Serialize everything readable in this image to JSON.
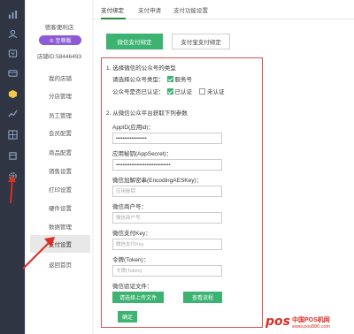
{
  "sidebar": {
    "shop_name": "德客便利店",
    "version_badge": "♔ 至尊版",
    "shop_id": "店铺ID:58446493",
    "items": [
      {
        "label": "我的店铺"
      },
      {
        "label": "分店管理"
      },
      {
        "label": "员工管理"
      },
      {
        "label": "会员配置"
      },
      {
        "label": "商品配置"
      },
      {
        "label": "销售设置"
      },
      {
        "label": "打印设置"
      },
      {
        "label": "硬件设置"
      },
      {
        "label": "数据管理"
      },
      {
        "label": "支付设置",
        "active": true
      },
      {
        "label": "返回首页"
      }
    ]
  },
  "rail_icons": [
    "bar-chart-icon",
    "user-icon",
    "cart-icon",
    "wallet-icon",
    "box-icon",
    "trend-icon",
    "grid-icon",
    "settings-icon"
  ],
  "tabs": [
    {
      "label": "支付绑定",
      "active": true
    },
    {
      "label": "支付申请"
    },
    {
      "label": "支付功能设置"
    }
  ],
  "bind_buttons": {
    "wechat": "微信支付绑定",
    "alipay": "支付宝支付绑定"
  },
  "section1": {
    "title": "1. 选择微信的公众号的类型",
    "type_label": "请选择公众号类型：",
    "type_option": "服务号",
    "type_checked": true,
    "verified_label": "公众号是否已认证：",
    "verified_option": "已认证",
    "verified_checked": true,
    "unverified_option": "未认证",
    "unverified_checked": false
  },
  "section2": {
    "title": "2. 从微信公众平台获取下列参数",
    "fields": [
      {
        "label": "AppID(应用id)：",
        "value": "••••••••••••••••••",
        "placeholder": ""
      },
      {
        "label": "应用秘钥(AppSecret)：",
        "value": "••••••••••••••••••••••••••••••••",
        "placeholder": ""
      },
      {
        "label": "微信加解密串(EncodingAESKey)：",
        "value": "",
        "placeholder": "应用秘钥"
      },
      {
        "label": "微信商户号：",
        "value": "",
        "placeholder": "微信商户号"
      },
      {
        "label": "微信支付Key：",
        "value": "",
        "placeholder": "微信支付Key"
      },
      {
        "label": "令牌(Token)：",
        "value": "",
        "placeholder": "令牌(Token)"
      }
    ],
    "verify_label": "微信验证文件：",
    "upload_button": "请选择上传文件",
    "flow_button": "查看流程",
    "confirm_button": "确定"
  },
  "watermark": {
    "brand": "pos",
    "cn": "中国POS机网",
    "url": "www.pos880.com"
  },
  "colors": {
    "accent_green": "#3cb371",
    "highlight_red": "#d9534f",
    "badge_purple": "#8e5bd6",
    "rail_dark": "#2f3542"
  }
}
